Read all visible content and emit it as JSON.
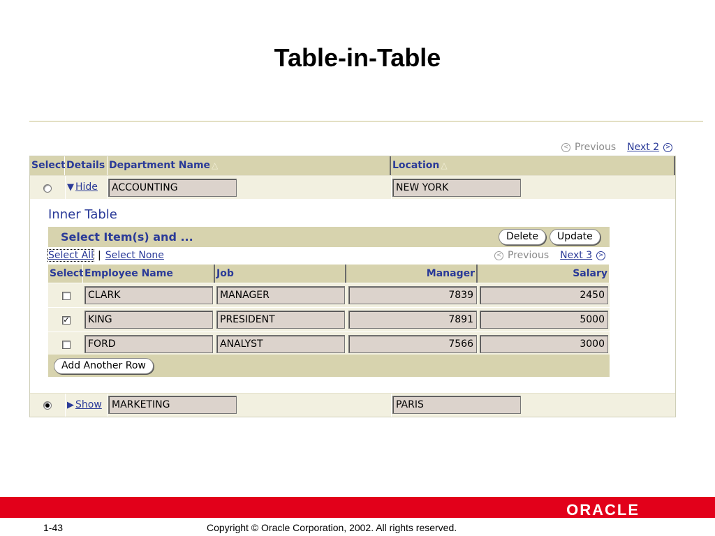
{
  "slide": {
    "title": "Table-in-Table",
    "page_number": "1-43",
    "copyright": "Copyright © Oracle Corporation, 2002. All rights reserved.",
    "logo_text": "ORACLE"
  },
  "outer_pager": {
    "previous": "Previous",
    "next": "Next 2"
  },
  "outer_table": {
    "headers": {
      "select": "Select",
      "details": "Details",
      "department_name": "Department Name",
      "location": "Location"
    },
    "rows": [
      {
        "selected": false,
        "disclosure": "Hide",
        "expanded": true,
        "department": "ACCOUNTING",
        "location": "NEW YORK"
      },
      {
        "selected": true,
        "disclosure": "Show",
        "expanded": false,
        "department": "MARKETING",
        "location": "PARIS"
      }
    ]
  },
  "inner_table": {
    "title": "Inner Table",
    "action_label": "Select Item(s) and ...",
    "buttons": {
      "delete": "Delete",
      "update": "Update",
      "add_row": "Add Another Row"
    },
    "select_all": "Select All",
    "select_none": "Select None",
    "pager": {
      "previous": "Previous",
      "next": "Next 3"
    },
    "headers": {
      "select": "Select",
      "employee_name": "Employee Name",
      "job": "Job",
      "manager": "Manager",
      "salary": "Salary"
    },
    "rows": [
      {
        "checked": false,
        "name": "CLARK",
        "job": "MANAGER",
        "manager": "7839",
        "salary": "2450"
      },
      {
        "checked": true,
        "name": "KING",
        "job": "PRESIDENT",
        "manager": "7891",
        "salary": "5000"
      },
      {
        "checked": false,
        "name": "FORD",
        "job": "ANALYST",
        "manager": "7566",
        "salary": "3000"
      }
    ]
  },
  "colors": {
    "header_bg": "#d7d3ae",
    "row_bg": "#f2f0e0",
    "link": "#2a3a98",
    "footer_red": "#e2001a"
  },
  "icons": {
    "previous": "circle-left-arrow-icon",
    "next": "circle-right-arrow-icon",
    "hide": "triangle-down-icon",
    "show": "triangle-right-icon",
    "sort": "triangle-up-icon"
  }
}
